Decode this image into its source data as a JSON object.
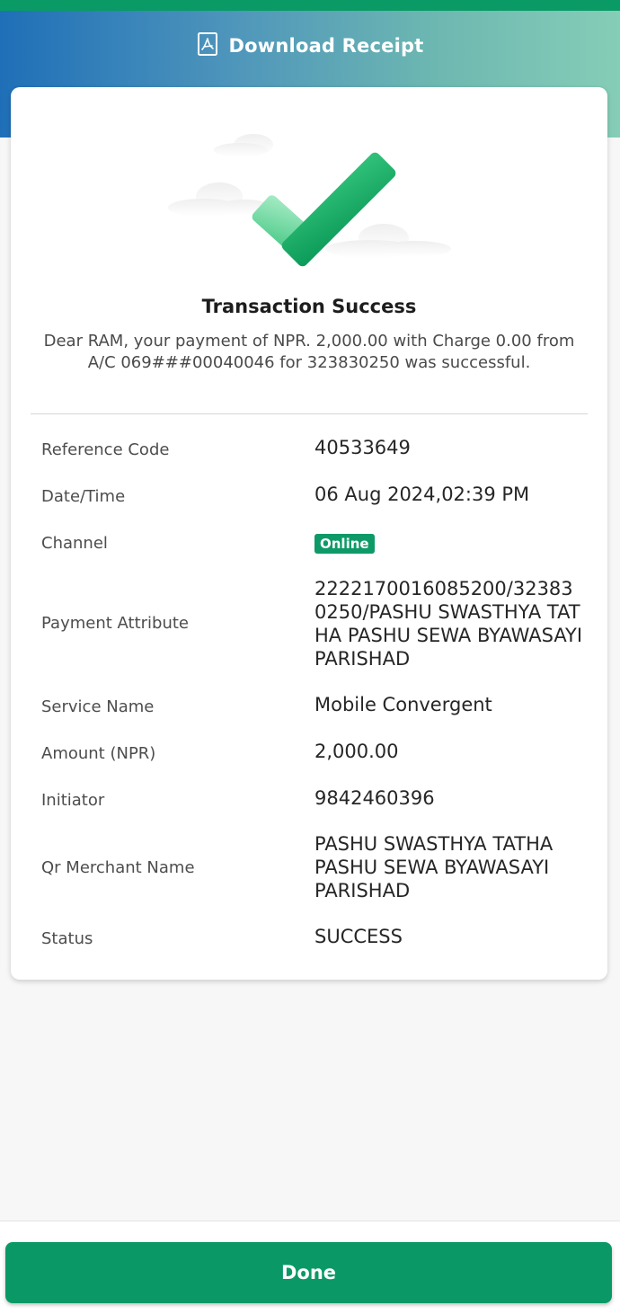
{
  "header": {
    "download_label": "Download Receipt",
    "download_icon": "pdf-icon"
  },
  "colors": {
    "brand_green": "#0a9966",
    "header_blue": "#1f6fb8",
    "header_mint": "#86cdb7"
  },
  "receipt": {
    "hero_icon": "checkmark-icon",
    "title": "Transaction Success",
    "message": "Dear RAM, your payment of NPR. 2,000.00 with Charge 0.00 from A/C 069###00040046 for 323830250 was successful.",
    "details": [
      {
        "label": "Reference Code",
        "value": "40533649"
      },
      {
        "label": "Date/Time",
        "value": "06 Aug 2024,02:39 PM"
      },
      {
        "label": "Channel",
        "value": "Online"
      },
      {
        "label": "Payment Attribute",
        "value": "2222170016085200/323830250/PASHU SWASTHYA TATHA PASHU SEWA BYAWASAYI PARISHAD"
      },
      {
        "label": "Service Name",
        "value": "Mobile Convergent"
      },
      {
        "label": "Amount (NPR)",
        "value": "2,000.00"
      },
      {
        "label": "Initiator",
        "value": "9842460396"
      },
      {
        "label": "Qr Merchant Name",
        "value": "PASHU SWASTHYA TATHA PASHU SEWA BYAWASAYI PARISHAD"
      },
      {
        "label": "Status",
        "value": "SUCCESS"
      }
    ]
  },
  "footer": {
    "done_label": "Done"
  }
}
